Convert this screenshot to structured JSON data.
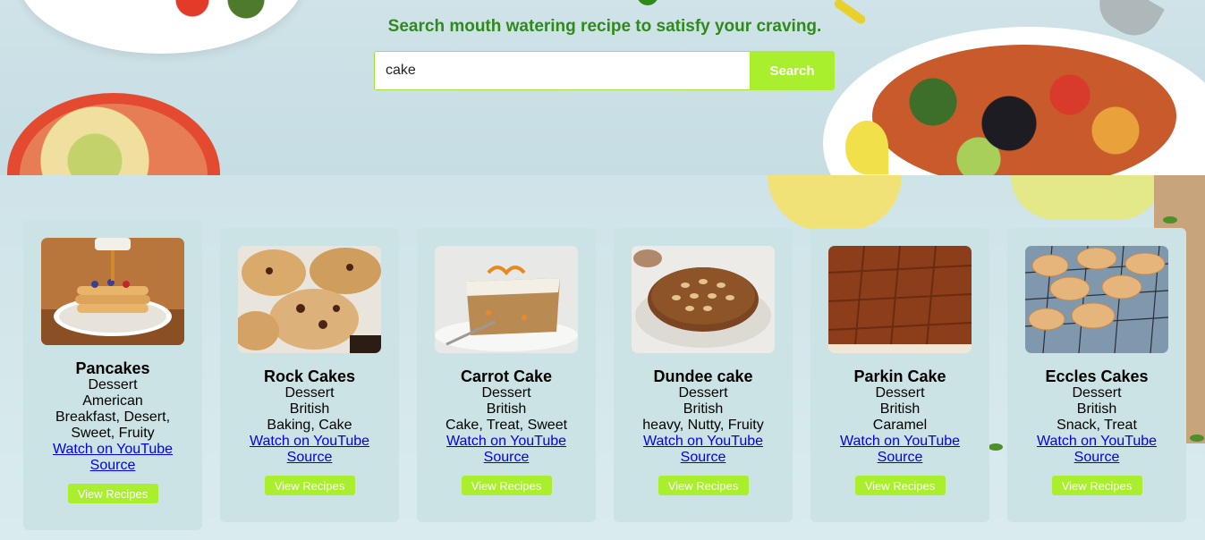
{
  "hero": {
    "tagline": "Search mouth watering recipe to satisfy your craving.",
    "search_value": "cake",
    "search_button": "Search"
  },
  "recipes": [
    {
      "name": "Pancakes",
      "category": "Dessert",
      "area": "American",
      "tags": "Breakfast, Desert, Sweet, Fruity",
      "youtube": "Watch on YouTube",
      "source": "Source",
      "button": "View Recipes",
      "image": "pancakes-photo"
    },
    {
      "name": "Rock Cakes",
      "category": "Dessert",
      "area": "British",
      "tags": "Baking, Cake",
      "youtube": "Watch on YouTube",
      "source": "Source",
      "button": "View Recipes",
      "image": "rock-cakes-photo"
    },
    {
      "name": "Carrot Cake",
      "category": "Dessert",
      "area": "British",
      "tags": "Cake, Treat, Sweet",
      "youtube": "Watch on YouTube",
      "source": "Source",
      "button": "View Recipes",
      "image": "carrot-cake-photo"
    },
    {
      "name": "Dundee cake",
      "category": "Dessert",
      "area": "British",
      "tags": "heavy, Nutty, Fruity",
      "youtube": "Watch on YouTube",
      "source": "Source",
      "button": "View Recipes",
      "image": "dundee-cake-photo"
    },
    {
      "name": "Parkin Cake",
      "category": "Dessert",
      "area": "British",
      "tags": "Caramel",
      "youtube": "Watch on YouTube",
      "source": "Source",
      "button": "View Recipes",
      "image": "parkin-cake-photo"
    },
    {
      "name": "Eccles Cakes",
      "category": "Dessert",
      "area": "British",
      "tags": "Snack, Treat",
      "youtube": "Watch on YouTube",
      "source": "Source",
      "button": "View Recipes",
      "image": "eccles-cakes-photo"
    }
  ],
  "colors": {
    "accent": "#a9ef2e",
    "tagline": "#2e8b1a",
    "card_bg": "#cbe3e5",
    "link": "#0000ee"
  }
}
